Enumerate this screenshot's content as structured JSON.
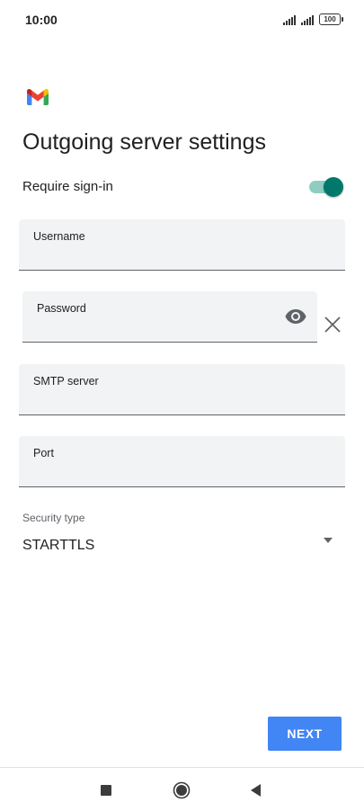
{
  "status_bar": {
    "time": "10:00",
    "battery": "100"
  },
  "app": {
    "logo_icon": "gmail-logo-icon"
  },
  "page": {
    "title": "Outgoing server settings"
  },
  "require_signin": {
    "label": "Require sign-in",
    "enabled": true
  },
  "fields": {
    "username": {
      "label": "Username",
      "value": ""
    },
    "password": {
      "label": "Password",
      "value": ""
    },
    "smtp_server": {
      "label": "SMTP server",
      "value": ""
    },
    "port": {
      "label": "Port",
      "value": ""
    }
  },
  "security": {
    "label": "Security type",
    "selected": "STARTTLS"
  },
  "actions": {
    "next_label": "NEXT"
  },
  "colors": {
    "accent": "#00796b",
    "toggle_track": "#8fcdc3",
    "button": "#4285f4",
    "field_bg": "#f1f3f4"
  },
  "navigation": {
    "recents_icon": "square-recents-icon",
    "home_icon": "circle-home-icon",
    "back_icon": "triangle-back-icon"
  }
}
